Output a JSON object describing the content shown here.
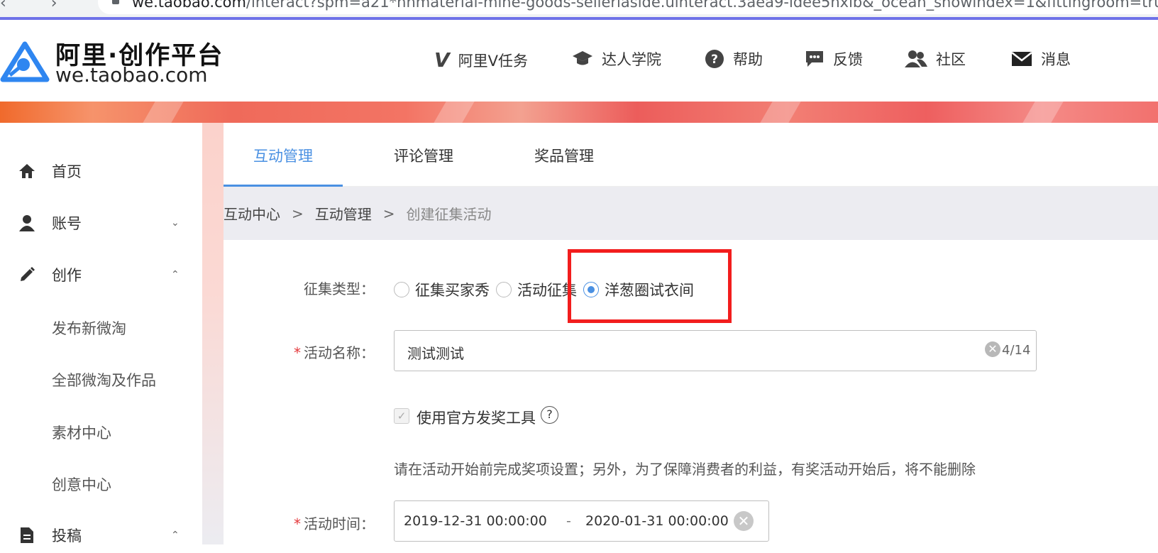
{
  "browser": {
    "nav_glyphs": "‹ › ⟳",
    "url_host": "we.taobao.com",
    "url_path": "/interact?spm=a21*nnmaterial-mine-goods-selleriaside.uinteract.3aea9-idee5nxib&_ocean_showindex=1&fittingroom=true"
  },
  "header": {
    "logo_title": "阿里·创作平台",
    "logo_sub": "we.taobao.com",
    "nav": [
      {
        "label": "阿里V任务",
        "icon": "v-icon"
      },
      {
        "label": "达人学院",
        "icon": "graduation-cap-icon"
      },
      {
        "label": "帮助",
        "icon": "help-icon"
      },
      {
        "label": "反馈",
        "icon": "feedback-icon"
      },
      {
        "label": "社区",
        "icon": "community-icon"
      },
      {
        "label": "消息",
        "icon": "mail-icon"
      }
    ]
  },
  "sidebar": {
    "items": [
      {
        "label": "首页",
        "icon": "home-icon"
      },
      {
        "label": "账号",
        "icon": "user-icon",
        "chevron": "⌄"
      },
      {
        "label": "创作",
        "icon": "pencil-icon",
        "chevron": "⌃"
      },
      {
        "label": "投稿",
        "icon": "document-icon",
        "chevron": "⌃"
      }
    ],
    "sub_items": [
      "发布新微淘",
      "全部微淘及作品",
      "素材中心",
      "创意中心"
    ]
  },
  "tabs": [
    {
      "label": "互动管理",
      "active": true
    },
    {
      "label": "评论管理",
      "active": false
    },
    {
      "label": "奖品管理",
      "active": false
    }
  ],
  "breadcrumb": [
    "互动中心",
    "互动管理",
    "创建征集活动"
  ],
  "breadcrumb_sep": ">",
  "form": {
    "collect_type_label": "征集类型：",
    "collect_options": [
      {
        "label": "征集买家秀",
        "selected": false
      },
      {
        "label": "活动征集",
        "selected": false
      },
      {
        "label": "洋葱圈试衣间",
        "selected": true
      }
    ],
    "required_mark": "*",
    "name_label": "活动名称：",
    "name_value": "测试测试",
    "name_counter": "4/14",
    "clear_glyph": "✕",
    "official_tool_label": "使用官方发奖工具",
    "official_tool_checked": true,
    "help_glyph": "?",
    "notice": "请在活动开始前完成奖项设置；另外，为了保障消费者的利益，有奖活动开始后，将不能删除",
    "time_label": "活动时间：",
    "start_time": "2019-12-31 00:00:00",
    "time_sep": "-",
    "end_time": "2020-01-31 00:00:00"
  },
  "colors": {
    "accent": "#4a90e2",
    "highlight_box": "#f21d1d",
    "required": "#e4393c"
  }
}
